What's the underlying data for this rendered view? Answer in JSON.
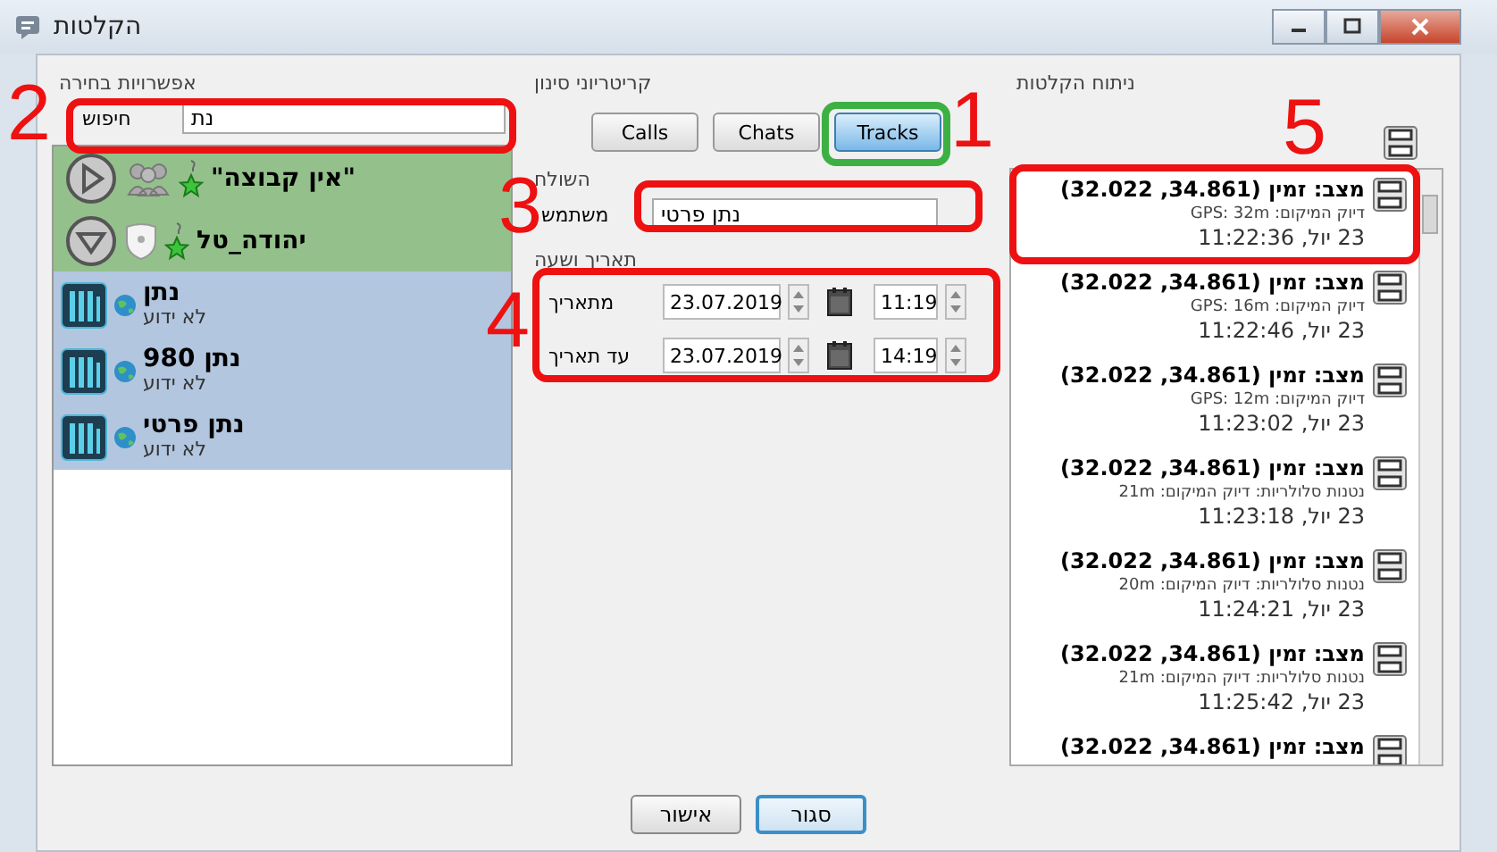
{
  "window": {
    "title": "הקלטות"
  },
  "selection_panel": {
    "title": "אפשרויות בחירה",
    "search_label": "חיפוש",
    "search_value": "נת",
    "groups": [
      {
        "name": "\"אין קבוצה\"",
        "expanded": false,
        "kind": "group"
      },
      {
        "name": "יהודה_טל",
        "expanded": true,
        "kind": "shield"
      }
    ],
    "users": [
      {
        "name": "נתן",
        "status": "לא ידוע"
      },
      {
        "name": "נתן 980",
        "status": "לא ידוע"
      },
      {
        "name": "נתן פרטי",
        "status": "לא ידוע"
      }
    ]
  },
  "filter_panel": {
    "title": "קריטריוני סינון",
    "buttons": [
      {
        "label": "Tracks",
        "selected": true
      },
      {
        "label": "Chats",
        "selected": false
      },
      {
        "label": "Calls",
        "selected": false
      }
    ],
    "sender_title": "השולח",
    "user_label": "משתמש",
    "user_value": "נתן פרטי",
    "date_title": "תאריך ושעה",
    "date_rows": [
      {
        "label": "מתאריך",
        "date": "23.07.2019",
        "time": "11:19"
      },
      {
        "label": "עד תאריך",
        "date": "23.07.2019",
        "time": "14:19"
      }
    ]
  },
  "analysis_panel": {
    "title": "ניתוח הקלטות",
    "items": [
      {
        "status": "מצב: זמין (34.861, 32.022)",
        "accuracy": "דיוק המיקום: GPS: 32m",
        "time": "23 יול, 11:22:36"
      },
      {
        "status": "מצב: זמין (34.861, 32.022)",
        "accuracy": "דיוק המיקום: GPS: 16m",
        "time": "23 יול, 11:22:46"
      },
      {
        "status": "מצב: זמין (34.861, 32.022)",
        "accuracy": "דיוק המיקום: GPS: 12m",
        "time": "23 יול, 11:23:02"
      },
      {
        "status": "מצב: זמין (34.861, 32.022)",
        "accuracy": "נטנות סלולריות: דיוק המיקום: 21m",
        "time": "23 יול, 11:23:18"
      },
      {
        "status": "מצב: זמין (34.861, 32.022)",
        "accuracy": "נטנות סלולריות: דיוק המיקום: 20m",
        "time": "23 יול, 11:24:21"
      },
      {
        "status": "מצב: זמין (34.861, 32.022)",
        "accuracy": "נטנות סלולריות: דיוק המיקום: 21m",
        "time": "23 יול, 11:25:42"
      },
      {
        "status": "מצב: זמין (34.861, 32.022)"
      }
    ]
  },
  "dialog_buttons": [
    {
      "label": "סגור",
      "selected": true
    },
    {
      "label": "אישור",
      "selected": false
    }
  ],
  "annotations": [
    {
      "label": "1",
      "color": "#3cb043"
    },
    {
      "label": "2",
      "color": "#ee1111"
    },
    {
      "label": "3",
      "color": "#ee1111"
    },
    {
      "label": "4",
      "color": "#ee1111"
    },
    {
      "label": "5",
      "color": "#ee1111"
    }
  ]
}
